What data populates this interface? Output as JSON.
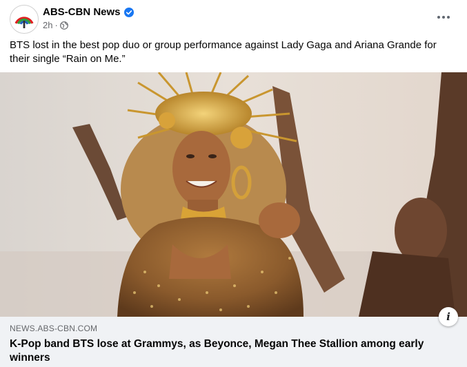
{
  "post": {
    "page_name": "ABS-CBN News",
    "time": "2h",
    "caption": "BTS lost in the best pop duo or group performance against Lady Gaga and Ariana Grande for their single “Rain on Me.”"
  },
  "link_preview": {
    "domain": "NEWS.ABS-CBN.COM",
    "headline": "K-Pop band BTS lose at Grammys, as Beyonce, Megan Thee Stallion among early winners",
    "info_icon_glyph": "i"
  },
  "icons": {
    "verified": "verified-badge-icon",
    "audience": "globe-icon",
    "more": "more-options-icon",
    "info": "info-icon"
  },
  "colors": {
    "verified_blue": "#1877f2",
    "link_background": "#f0f2f5",
    "secondary_text": "#65676b"
  }
}
